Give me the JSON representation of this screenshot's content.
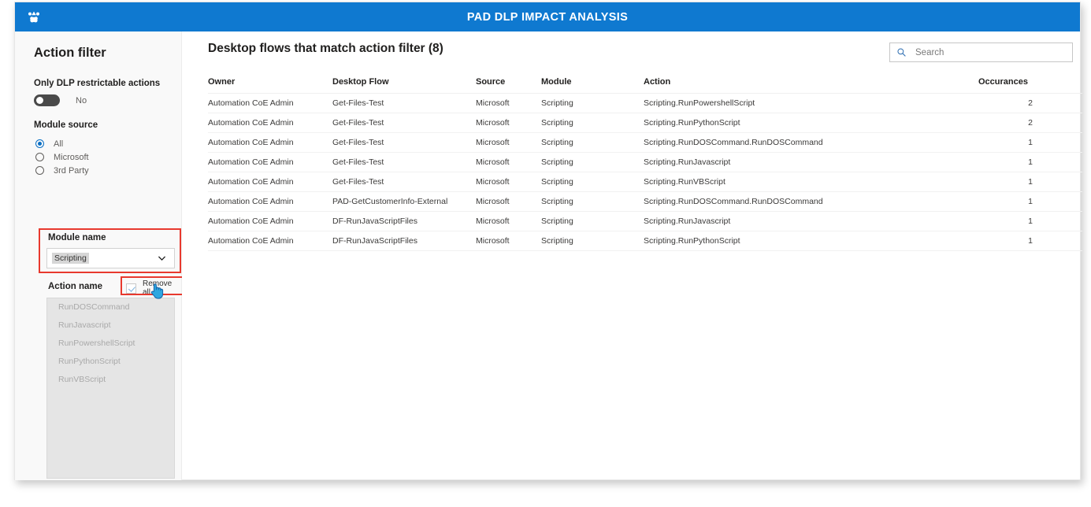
{
  "titlebar": {
    "title": "PAD DLP IMPACT ANALYSIS",
    "logo_icon": "power-apps-logo-icon",
    "bg_color": "#0f79d0"
  },
  "sidebar": {
    "title": "Action filter",
    "dlp_toggle": {
      "label": "Only DLP restrictable actions",
      "value": "No",
      "state": "off"
    },
    "module_source": {
      "label": "Module source",
      "options": [
        {
          "label": "All",
          "checked": true
        },
        {
          "label": "Microsoft",
          "checked": false
        },
        {
          "label": "3rd Party",
          "checked": false
        }
      ]
    },
    "module_name": {
      "label": "Module name",
      "selected": "Scripting",
      "chevron_icon": "chevron-down-icon",
      "highlight_color": "#e8392e"
    },
    "action_name": {
      "label": "Action name",
      "remove_all_label": "Remove all",
      "remove_all_checked": true,
      "items": [
        "RunDOSCommand",
        "RunJavascript",
        "RunPowershellScript",
        "RunPythonScript",
        "RunVBScript"
      ]
    }
  },
  "main": {
    "title": "Desktop flows that match action filter (8)",
    "search": {
      "placeholder": "Search",
      "value": "",
      "icon": "search-icon"
    },
    "table": {
      "columns": [
        "Owner",
        "Desktop Flow",
        "Source",
        "Module",
        "Action",
        "Occurances"
      ],
      "rows": [
        {
          "owner": "Automation CoE Admin",
          "flow": "Get-Files-Test",
          "source": "Microsoft",
          "module": "Scripting",
          "action": "Scripting.RunPowershellScript",
          "occurances": "2"
        },
        {
          "owner": "Automation CoE Admin",
          "flow": "Get-Files-Test",
          "source": "Microsoft",
          "module": "Scripting",
          "action": "Scripting.RunPythonScript",
          "occurances": "2"
        },
        {
          "owner": "Automation CoE Admin",
          "flow": "Get-Files-Test",
          "source": "Microsoft",
          "module": "Scripting",
          "action": "Scripting.RunDOSCommand.RunDOSCommand",
          "occurances": "1"
        },
        {
          "owner": "Automation CoE Admin",
          "flow": "Get-Files-Test",
          "source": "Microsoft",
          "module": "Scripting",
          "action": "Scripting.RunJavascript",
          "occurances": "1"
        },
        {
          "owner": "Automation CoE Admin",
          "flow": "Get-Files-Test",
          "source": "Microsoft",
          "module": "Scripting",
          "action": "Scripting.RunVBScript",
          "occurances": "1"
        },
        {
          "owner": "Automation CoE Admin",
          "flow": "PAD-GetCustomerInfo-External",
          "source": "Microsoft",
          "module": "Scripting",
          "action": "Scripting.RunDOSCommand.RunDOSCommand",
          "occurances": "1"
        },
        {
          "owner": "Automation CoE Admin",
          "flow": "DF-RunJavaScriptFiles",
          "source": "Microsoft",
          "module": "Scripting",
          "action": "Scripting.RunJavascript",
          "occurances": "1"
        },
        {
          "owner": "Automation CoE Admin",
          "flow": "DF-RunJavaScriptFiles",
          "source": "Microsoft",
          "module": "Scripting",
          "action": "Scripting.RunPythonScript",
          "occurances": "1"
        }
      ]
    }
  },
  "cursor": {
    "icon": "hand-pointer-cursor"
  }
}
